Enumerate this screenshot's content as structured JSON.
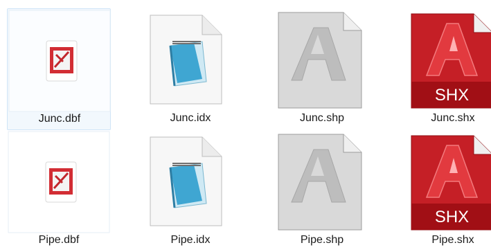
{
  "files": [
    {
      "name": "Junc.dbf",
      "type": "dbf",
      "selected": true
    },
    {
      "name": "Junc.idx",
      "type": "idx",
      "selected": false
    },
    {
      "name": "Junc.shp",
      "type": "shp",
      "selected": false
    },
    {
      "name": "Junc.shx",
      "type": "shx",
      "selected": false
    },
    {
      "name": "Pipe.dbf",
      "type": "dbf",
      "selected": false
    },
    {
      "name": "Pipe.idx",
      "type": "idx",
      "selected": false
    },
    {
      "name": "Pipe.shp",
      "type": "shp",
      "selected": false
    },
    {
      "name": "Pipe.shx",
      "type": "shx",
      "selected": false
    }
  ],
  "icons": {
    "dbf": "dbf-file-icon",
    "idx": "notepad-file-icon",
    "shp": "autocad-shp-file-icon",
    "shx": "autocad-shx-file-icon",
    "shx_badge": "SHX"
  },
  "colors": {
    "selection_bg": "#f2f8fd",
    "selection_border": "#cfe4f7",
    "shx_red": "#b3141c",
    "shp_gray": "#c8c8c8"
  }
}
